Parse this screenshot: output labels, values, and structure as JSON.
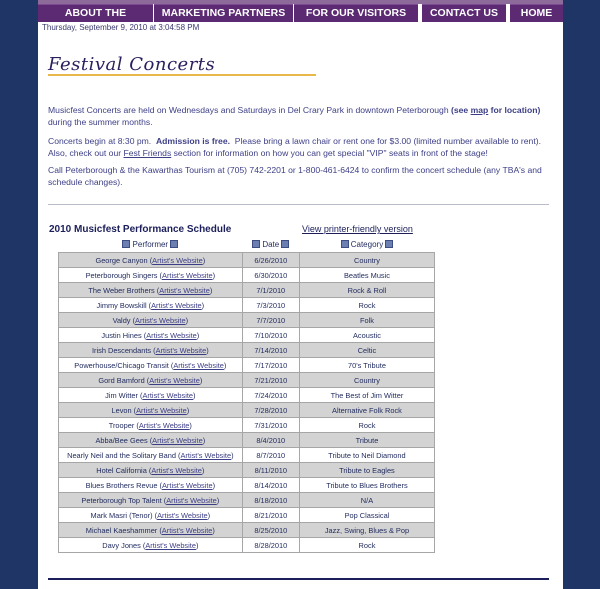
{
  "nav": {
    "items": [
      {
        "label": "ABOUT THE MUSICFEST"
      },
      {
        "label": "MARKETING PARTNERS"
      },
      {
        "label": "FOR OUR VISITORS"
      },
      {
        "label": "CONTACT US"
      },
      {
        "label": "HOME"
      }
    ]
  },
  "timestamp": "Thursday, September 9, 2010 at 3:04:58 PM",
  "page_title": "Festival Concerts",
  "intro": {
    "p1_a": "Musicfest Concerts are held on Wednesdays and Saturdays in Del Crary Park in downtown Peterborough ",
    "p1_see": "(see ",
    "p1_map": "map",
    "p1_for": " for location)",
    "p1_b": "during the summer months.",
    "p2_a": "Concerts begin at 8:30 pm.",
    "p2_admission": "Admission is free.",
    "p2_b": "Please bring a lawn chair or rent one for $3.00 (limited number available to rent).",
    "p2_c": "Also, check out our ",
    "p2_link": "Fest Friends",
    "p2_d": " section for information on how you can get special \"VIP\" seats in front of the stage!",
    "p3": "Call Peterborough & the Kawarthas Tourism at (705) 742-2201 or 1-800-461-6424 to confirm the concert schedule (any TBA's and schedule changes)."
  },
  "schedule": {
    "title": "2010 Musicfest Performance Schedule",
    "printer_link": "View printer-friendly version",
    "headers": {
      "performer": "Performer",
      "date": "Date",
      "category": "Category"
    },
    "link_label": "Artist's Website",
    "rows": [
      {
        "performer": "George Canyon",
        "date": "6/26/2010",
        "category": "Country"
      },
      {
        "performer": "Peterborough Singers",
        "date": "6/30/2010",
        "category": "Beatles Music"
      },
      {
        "performer": "The Weber Brothers",
        "date": "7/1/2010",
        "category": "Rock & Roll"
      },
      {
        "performer": "Jimmy Bowskill",
        "date": "7/3/2010",
        "category": "Rock"
      },
      {
        "performer": "Valdy",
        "date": "7/7/2010",
        "category": "Folk"
      },
      {
        "performer": "Justin Hines",
        "date": "7/10/2010",
        "category": "Acoustic"
      },
      {
        "performer": "Irish Descendants",
        "date": "7/14/2010",
        "category": "Celtic"
      },
      {
        "performer": "Powerhouse/Chicago Transit",
        "date": "7/17/2010",
        "category": "70's Tribute"
      },
      {
        "performer": "Gord Bamford",
        "date": "7/21/2010",
        "category": "Country"
      },
      {
        "performer": "Jim Witter",
        "date": "7/24/2010",
        "category": "The Best of Jim Witter"
      },
      {
        "performer": "Levon",
        "date": "7/28/2010",
        "category": "Alternative Folk Rock"
      },
      {
        "performer": "Trooper",
        "date": "7/31/2010",
        "category": "Rock"
      },
      {
        "performer": "Abba/Bee Gees",
        "date": "8/4/2010",
        "category": "Tribute"
      },
      {
        "performer": "Nearly Neil and the Solitary Band",
        "date": "8/7/2010",
        "category": "Tribute to Neil Diamond"
      },
      {
        "performer": "Hotel California",
        "date": "8/11/2010",
        "category": "Tribute to Eagles"
      },
      {
        "performer": "Blues Brothers Revue",
        "date": "8/14/2010",
        "category": "Tribute to Blues Brothers"
      },
      {
        "performer": "Peterborough Top Talent",
        "date": "8/18/2010",
        "category": "N/A"
      },
      {
        "performer": "Mark Masri (Tenor)",
        "date": "8/21/2010",
        "category": "Pop Classical"
      },
      {
        "performer": "Michael Kaeshammer",
        "date": "8/25/2010",
        "category": "Jazz, Swing, Blues & Pop"
      },
      {
        "performer": "Davy Jones",
        "date": "8/28/2010",
        "category": "Rock"
      }
    ]
  }
}
